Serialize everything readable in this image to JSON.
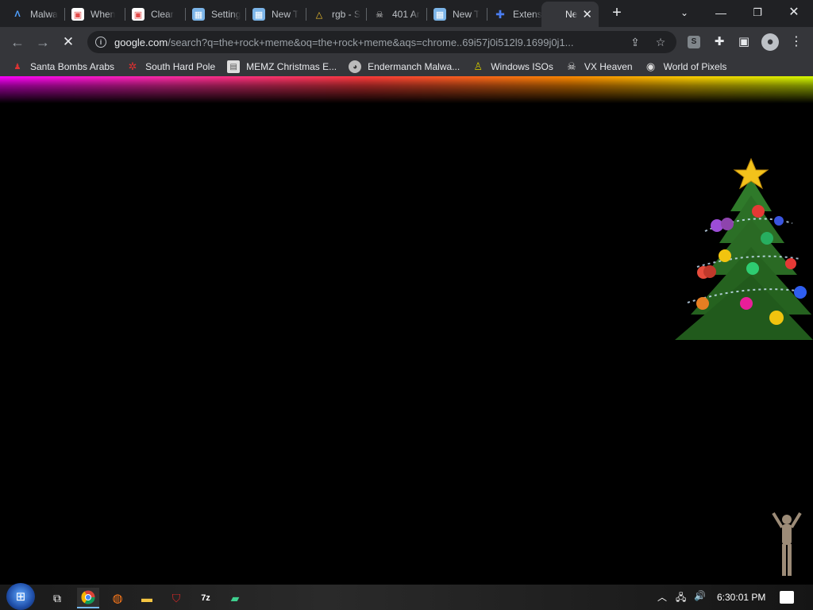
{
  "tabs": [
    {
      "title": "Malwa",
      "icon": "malware-wiki-icon",
      "glyph": "A",
      "color": "#4fa0ff"
    },
    {
      "title": "When",
      "icon": "book-icon",
      "glyph": "▣",
      "color": "#e24a4a"
    },
    {
      "title": "Clear",
      "icon": "book-icon",
      "glyph": "▣",
      "color": "#e24a4a"
    },
    {
      "title": "Setting",
      "icon": "image-icon",
      "glyph": "▦",
      "color": "#7bb4e8"
    },
    {
      "title": "New T",
      "icon": "image-icon",
      "glyph": "▦",
      "color": "#7bb4e8"
    },
    {
      "title": "rgb - S",
      "icon": "google-drive-icon",
      "glyph": "△",
      "color": "#f2c12e"
    },
    {
      "title": "401 Ar",
      "icon": "hacker-icon",
      "glyph": "☠",
      "color": "#d0d0d0"
    },
    {
      "title": "New T",
      "icon": "image-icon",
      "glyph": "▦",
      "color": "#7bb4e8"
    },
    {
      "title": "Extens",
      "icon": "puzzle-icon",
      "glyph": "✚",
      "color": "#4a7df0"
    },
    {
      "title": "Ne",
      "icon": "",
      "glyph": "",
      "color": "#e8eaed"
    }
  ],
  "omnibox": {
    "host": "google.com",
    "path": "/search?q=the+rock+meme&oq=the+rock+meme&aqs=chrome..69i57j0i512l9.1699j0j1..."
  },
  "profile_badge": "S",
  "bookmarks": [
    {
      "label": "Santa Bombs Arabs",
      "icon": "santa-icon",
      "glyph": "🎅",
      "color": "#c0392b"
    },
    {
      "label": "South Hard Pole",
      "icon": "snowflake-icon",
      "glyph": "✲",
      "color": "#e03030"
    },
    {
      "label": "MEMZ Christmas E...",
      "icon": "page-icon",
      "glyph": "▤",
      "color": "#dddddd"
    },
    {
      "label": "Endermanch Malwa...",
      "icon": "raccoon-icon",
      "glyph": "◕",
      "color": "#cccccc"
    },
    {
      "label": "Windows ISOs",
      "icon": "person-icon",
      "glyph": "♙",
      "color": "#c8c000"
    },
    {
      "label": "VX Heaven",
      "icon": "hacker-icon",
      "glyph": "☠",
      "color": "#dddddd"
    },
    {
      "label": "World of Pixels",
      "icon": "palette-icon",
      "glyph": "◉",
      "color": "#dddddd"
    }
  ],
  "clock": "6:30:01 PM"
}
